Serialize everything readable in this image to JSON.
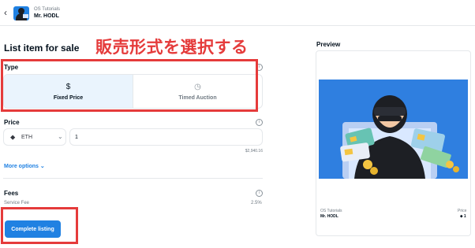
{
  "header": {
    "back_icon": "chevron-left-icon",
    "collection": "OS Tutorials",
    "item_name": "Mr. HODL"
  },
  "main": {
    "title": "List item for sale",
    "annotation": "販売形式を選択する",
    "type": {
      "label": "Type",
      "options": [
        {
          "icon": "dollar-icon",
          "glyph": "$",
          "label": "Fixed Price",
          "selected": true
        },
        {
          "icon": "clock-icon",
          "glyph": "◷",
          "label": "Timed Auction",
          "selected": false
        }
      ]
    },
    "price": {
      "label": "Price",
      "currency": "ETH",
      "amount": "1",
      "usd": "$2,940.16"
    },
    "more_options": "More options",
    "fees": {
      "label": "Fees",
      "service_fee_label": "Service Fee",
      "service_fee_value": "2.5%"
    },
    "complete_button": "Complete listing"
  },
  "preview": {
    "title": "Preview",
    "collection": "OS Tutorials",
    "name": "Mr. HODL",
    "price_label": "Price",
    "price_value": "1"
  },
  "colors": {
    "accent": "#2081e2",
    "annotation_red": "#e53b3b",
    "nft_background": "#2f7fe0"
  }
}
